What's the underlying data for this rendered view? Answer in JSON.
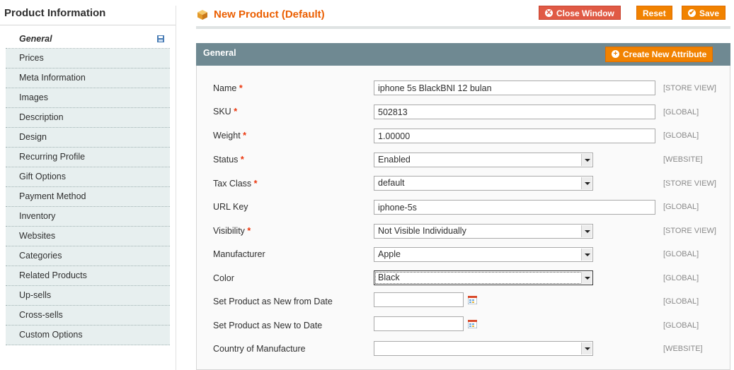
{
  "sidebar": {
    "title": "Product Information",
    "items": [
      {
        "label": "General",
        "active": true,
        "icon": "save-icon"
      },
      {
        "label": "Prices"
      },
      {
        "label": "Meta Information"
      },
      {
        "label": "Images"
      },
      {
        "label": "Description"
      },
      {
        "label": "Design"
      },
      {
        "label": "Recurring Profile"
      },
      {
        "label": "Gift Options"
      },
      {
        "label": "Payment Method"
      },
      {
        "label": "Inventory"
      },
      {
        "label": "Websites"
      },
      {
        "label": "Categories"
      },
      {
        "label": "Related Products"
      },
      {
        "label": "Up-sells"
      },
      {
        "label": "Cross-sells"
      },
      {
        "label": "Custom Options"
      }
    ]
  },
  "header": {
    "title": "New Product (Default)",
    "icon": "product-box-icon",
    "buttons": {
      "close": "Close Window",
      "reset": "Reset",
      "save": "Save"
    }
  },
  "panel": {
    "title": "General",
    "create_attribute": "Create New Attribute"
  },
  "form": {
    "required_mark": "*",
    "fields": [
      {
        "label": "Name",
        "required": true,
        "type": "text",
        "value": "iphone 5s BlackBNI 12 bulan",
        "scope": "[STORE VIEW]"
      },
      {
        "label": "SKU",
        "required": true,
        "type": "text",
        "value": "502813",
        "scope": "[GLOBAL]"
      },
      {
        "label": "Weight",
        "required": true,
        "type": "text",
        "value": "1.00000",
        "scope": "[GLOBAL]"
      },
      {
        "label": "Status",
        "required": true,
        "type": "select",
        "value": "Enabled",
        "scope": "[WEBSITE]"
      },
      {
        "label": "Tax Class",
        "required": true,
        "type": "select",
        "value": "default",
        "scope": "[STORE VIEW]"
      },
      {
        "label": "URL Key",
        "required": false,
        "type": "text",
        "value": "iphone-5s",
        "scope": "[GLOBAL]"
      },
      {
        "label": "Visibility",
        "required": true,
        "type": "select",
        "value": "Not Visible Individually",
        "scope": "[STORE VIEW]"
      },
      {
        "label": "Manufacturer",
        "required": false,
        "type": "select",
        "value": "Apple",
        "scope": "[GLOBAL]"
      },
      {
        "label": "Color",
        "required": false,
        "type": "select",
        "value": "Black",
        "scope": "[GLOBAL]"
      },
      {
        "label": "Set Product as New from Date",
        "required": false,
        "type": "date",
        "value": "",
        "scope": "[GLOBAL]"
      },
      {
        "label": "Set Product as New to Date",
        "required": false,
        "type": "date",
        "value": "",
        "scope": "[GLOBAL]"
      },
      {
        "label": "Country of Manufacture",
        "required": false,
        "type": "select",
        "value": "",
        "scope": "[WEBSITE]"
      }
    ]
  },
  "colors": {
    "accent_orange": "#f18200",
    "title_orange": "#eb5e00",
    "close_red": "#e05a45",
    "panel_header": "#6f8992",
    "sidebar_item_bg": "#e7efef"
  }
}
